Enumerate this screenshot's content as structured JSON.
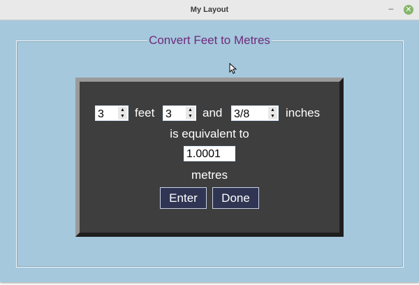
{
  "window": {
    "title": "My Layout",
    "minimize_glyph": "–",
    "close_glyph": "✕",
    "close_color": "#86b56a"
  },
  "group": {
    "title": "Convert Feet to Metres"
  },
  "converter": {
    "feet_value": "3",
    "feet_label": "feet",
    "inches_value": "3",
    "and_label": "and",
    "fraction_value": "3/8",
    "inches_label": "inches",
    "equiv_label": "is equivalent to",
    "result_value": "1.0001",
    "metres_label": "metres",
    "enter_label": "Enter",
    "done_label": "Done"
  },
  "icons": {
    "spin_up": "▲",
    "spin_down": "▼"
  },
  "colors": {
    "background": "#a5c8dc",
    "panel": "#3e3e3e",
    "title_text": "#6e2a7b",
    "button": "#2f3552"
  }
}
